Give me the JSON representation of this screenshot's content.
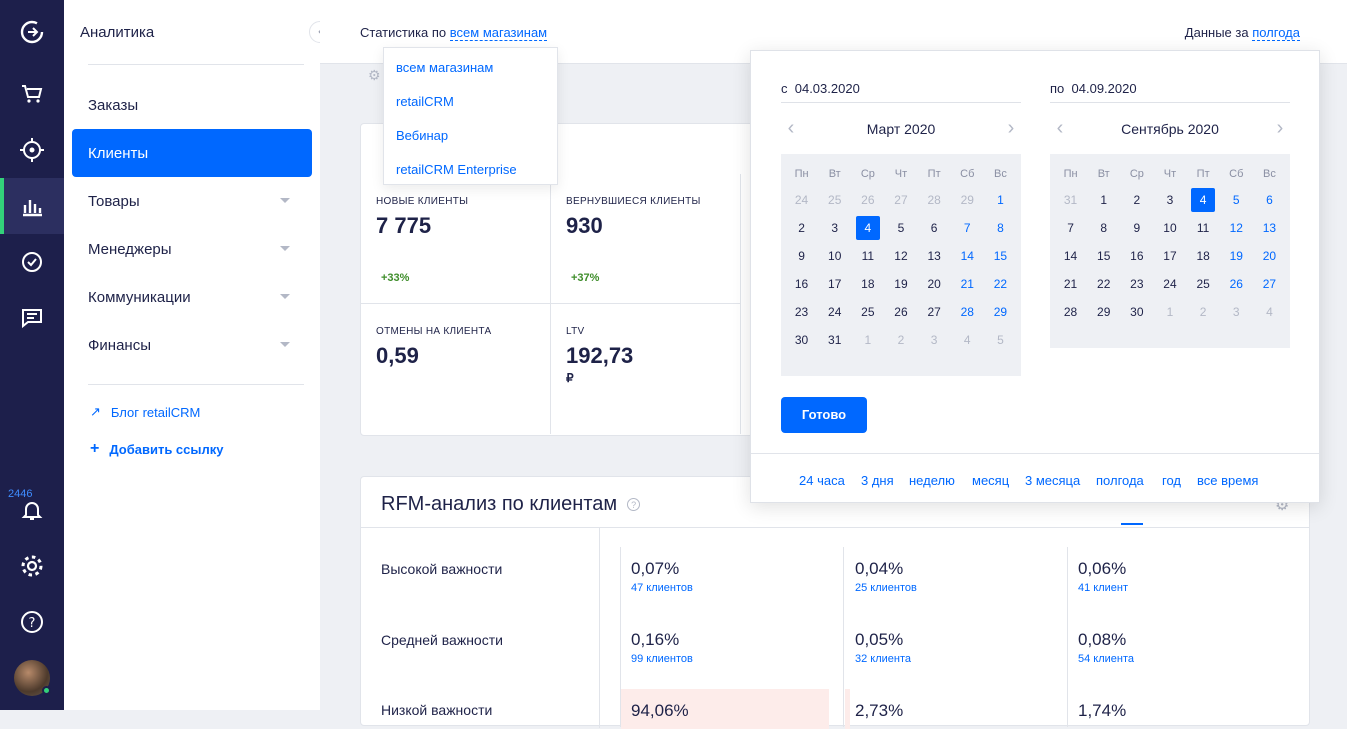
{
  "rail": {
    "badge_count": "2446"
  },
  "sidebar": {
    "title": "Аналитика",
    "items": [
      {
        "label": "Заказы"
      },
      {
        "label": "Клиенты"
      },
      {
        "label": "Товары"
      },
      {
        "label": "Менеджеры"
      },
      {
        "label": "Коммуникации"
      },
      {
        "label": "Финансы"
      }
    ],
    "blog_link": "Блог retailCRM",
    "add_link": "Добавить ссылку"
  },
  "header": {
    "stats_prefix": "Статистика по",
    "store_filter": "всем магазинам",
    "period_prefix": "Данные за",
    "period_value": "полгода"
  },
  "store_dropdown": {
    "options": [
      "всем магазинам",
      "retailCRM",
      "Вебинар",
      "retailCRM Enterprise"
    ]
  },
  "kpis": [
    {
      "label": "НОВЫЕ КЛИЕНТЫ",
      "value": "7 775",
      "delta": "+33%"
    },
    {
      "label": "ВЕРНУВШИЕСЯ КЛИЕНТЫ",
      "value": "930",
      "delta": "+37%"
    },
    {
      "label": "ОТМЕНЫ НА КЛИЕНТА",
      "value": "0,59"
    },
    {
      "label": "LTV",
      "value": "192,73",
      "currency": "₽"
    }
  ],
  "rfm": {
    "title": "RFM-анализ по клиентам",
    "rows": [
      {
        "label": "Высокой важности",
        "cells": [
          {
            "pct": "0,07%",
            "count": "47 клиентов"
          },
          {
            "pct": "0,04%",
            "count": "25 клиентов"
          },
          {
            "pct": "0,06%",
            "count": "41 клиент"
          }
        ]
      },
      {
        "label": "Средней важности",
        "cells": [
          {
            "pct": "0,16%",
            "count": "99 клиентов"
          },
          {
            "pct": "0,05%",
            "count": "32 клиента"
          },
          {
            "pct": "0,08%",
            "count": "54 клиента"
          }
        ]
      },
      {
        "label": "Низкой важности",
        "cells": [
          {
            "pct": "94,06%",
            "count": ""
          },
          {
            "pct": "2,73%",
            "count": ""
          },
          {
            "pct": "1,74%",
            "count": ""
          }
        ]
      }
    ]
  },
  "date_picker": {
    "from_prefix": "с",
    "from_value": "04.03.2020",
    "to_prefix": "по",
    "to_value": "04.09.2020",
    "weekdays": [
      "Пн",
      "Вт",
      "Ср",
      "Чт",
      "Пт",
      "Сб",
      "Вс"
    ],
    "left_month": "Март 2020",
    "right_month": "Сентябрь 2020",
    "left_days": [
      [
        "24",
        "25",
        "26",
        "27",
        "28",
        "29",
        "1"
      ],
      [
        "2",
        "3",
        "4",
        "5",
        "6",
        "7",
        "8"
      ],
      [
        "9",
        "10",
        "11",
        "12",
        "13",
        "14",
        "15"
      ],
      [
        "16",
        "17",
        "18",
        "19",
        "20",
        "21",
        "22"
      ],
      [
        "23",
        "24",
        "25",
        "26",
        "27",
        "28",
        "29"
      ],
      [
        "30",
        "31",
        "1",
        "2",
        "3",
        "4",
        "5"
      ]
    ],
    "right_days": [
      [
        "31",
        "1",
        "2",
        "3",
        "4",
        "5",
        "6"
      ],
      [
        "7",
        "8",
        "9",
        "10",
        "11",
        "12",
        "13"
      ],
      [
        "14",
        "15",
        "16",
        "17",
        "18",
        "19",
        "20"
      ],
      [
        "21",
        "22",
        "23",
        "24",
        "25",
        "26",
        "27"
      ],
      [
        "28",
        "29",
        "30",
        "1",
        "2",
        "3",
        "4"
      ]
    ],
    "done_label": "Готово",
    "quick_ranges": [
      "24 часа",
      "3 дня",
      "неделю",
      "месяц",
      "3 месяца",
      "полгода",
      "год",
      "все время"
    ]
  },
  "colors": {
    "accent": "#0068ff",
    "rail": "#1d1f4b",
    "positive": "#3e8d2a",
    "active_rail": "#33d17a"
  }
}
